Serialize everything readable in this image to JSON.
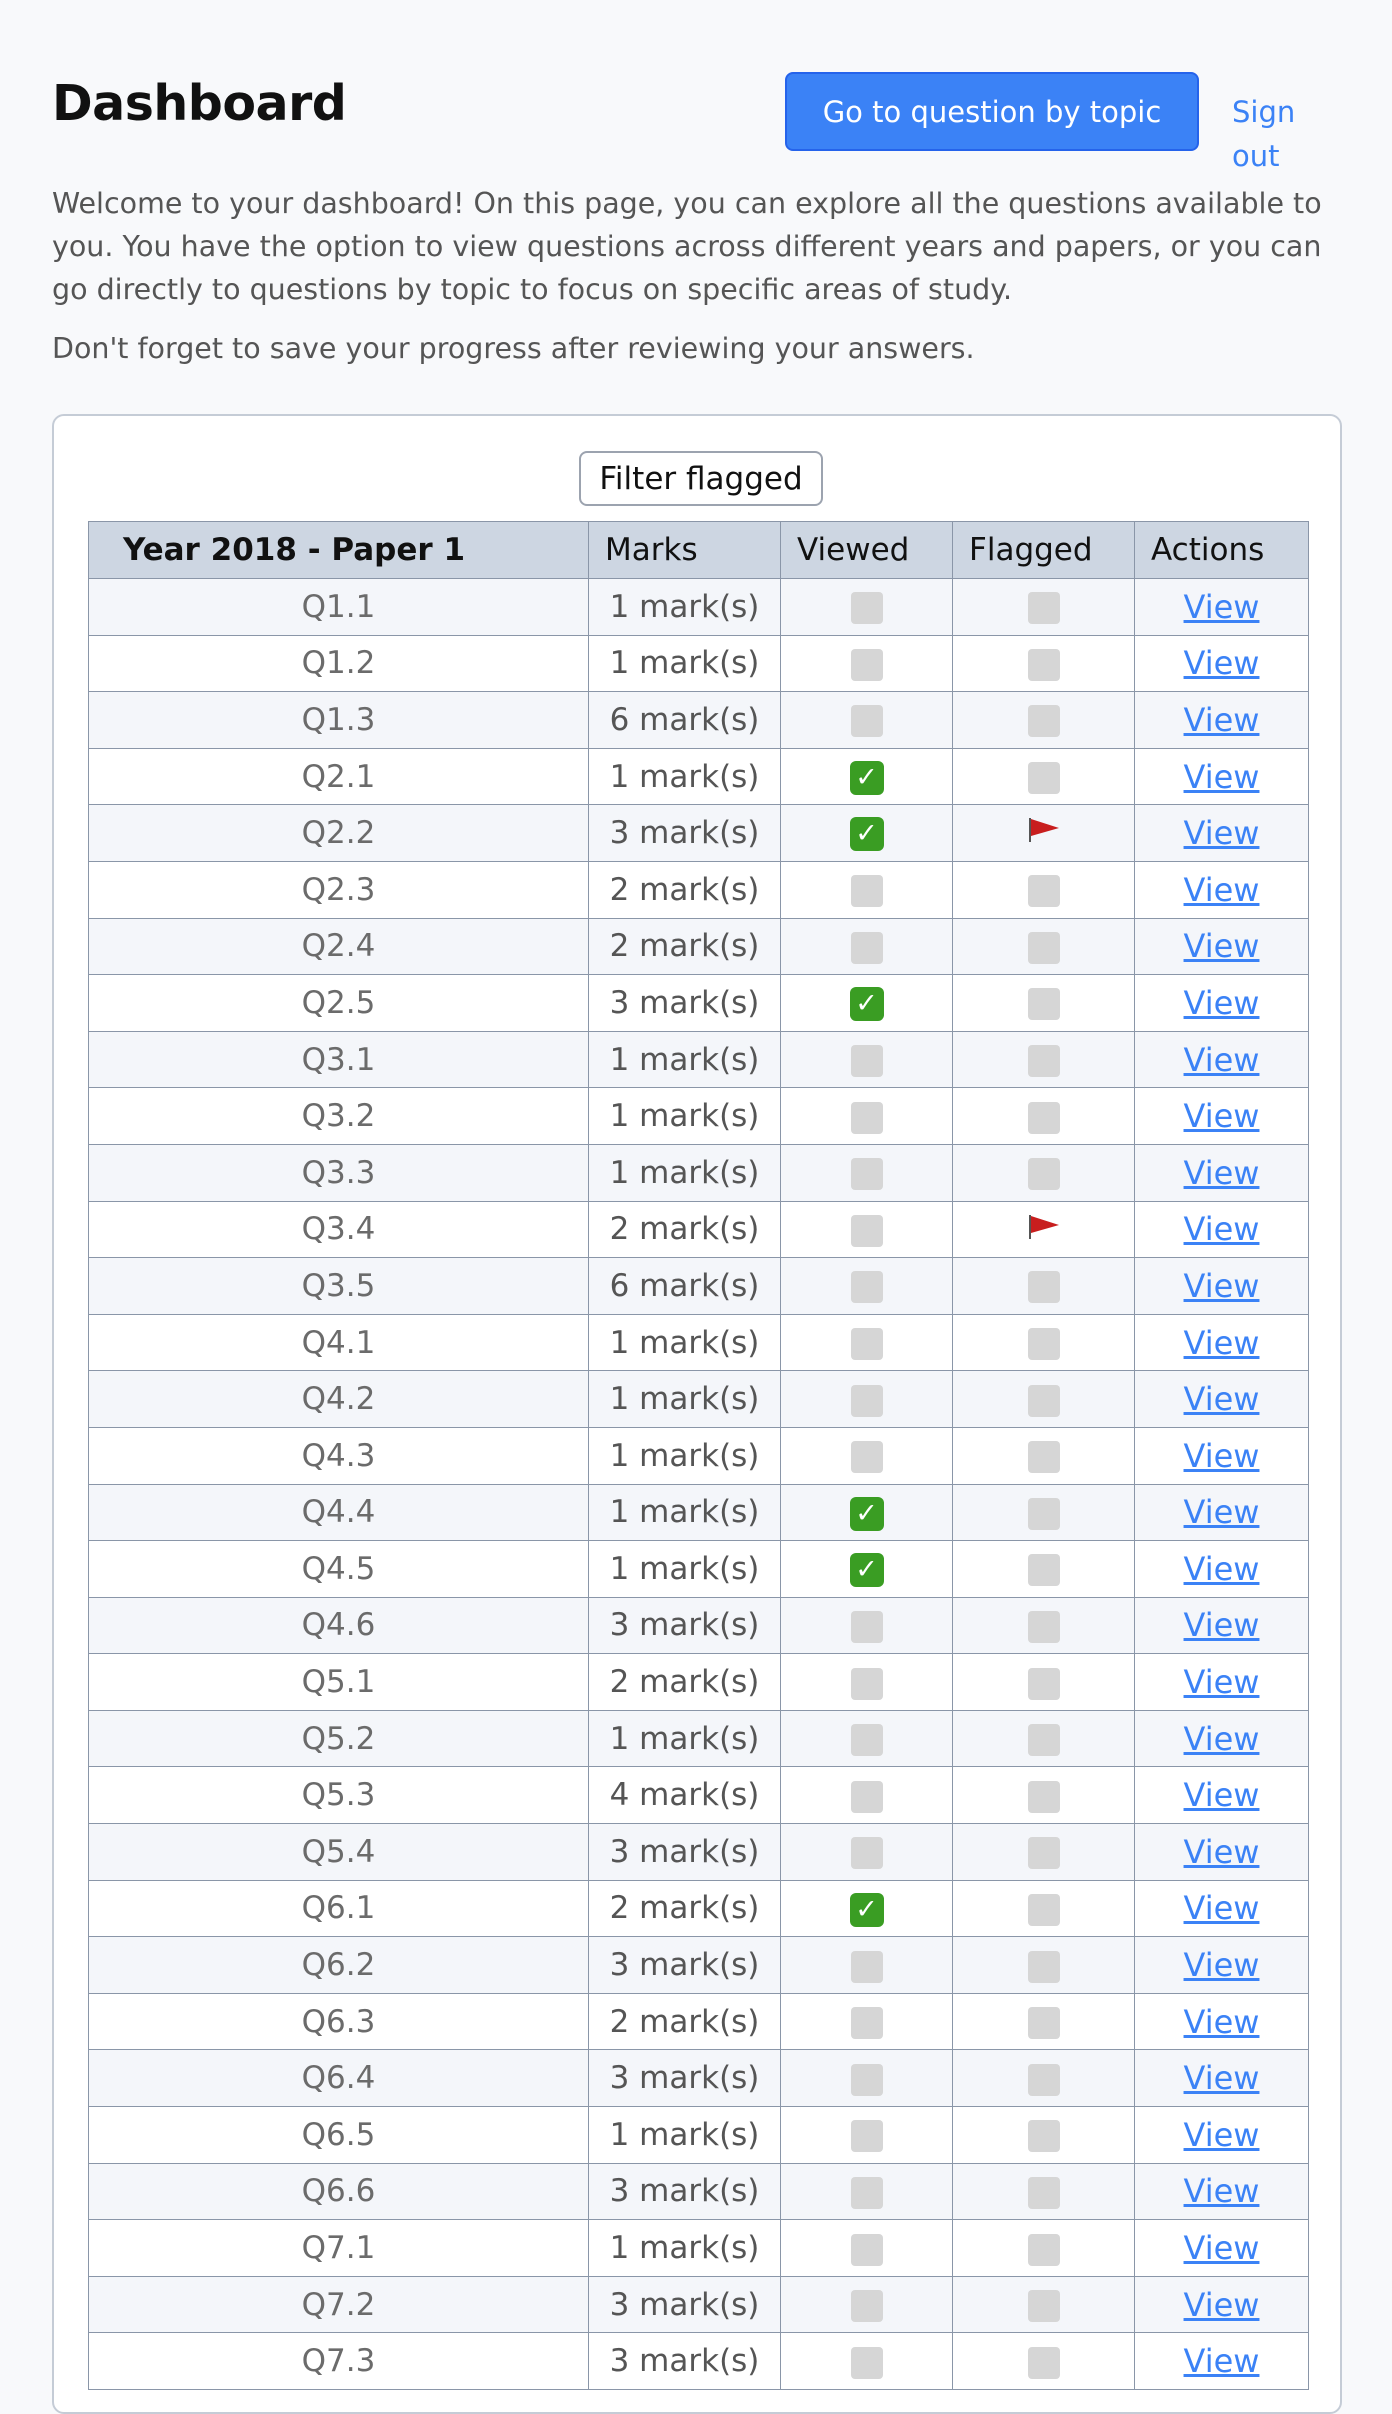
{
  "header": {
    "title": "Dashboard",
    "topic_button": "Go to question by topic",
    "signout": "Sign out"
  },
  "intro": {
    "paragraph1": "Welcome to your dashboard! On this page, you can explore all the questions available to you. You have the option to view questions across different years and papers, or you can go directly to questions by topic to focus on specific areas of study.",
    "paragraph2": "Don't forget to save your progress after reviewing your answers."
  },
  "filter_label": "Filter flagged",
  "table": {
    "columns": [
      "Year 2018 - Paper 1",
      "Marks",
      "Viewed",
      "Flagged",
      "Actions"
    ],
    "action_label": "View",
    "rows": [
      {
        "q": "Q1.1",
        "marks": "1 mark(s)",
        "viewed": false,
        "flagged": false
      },
      {
        "q": "Q1.2",
        "marks": "1 mark(s)",
        "viewed": false,
        "flagged": false
      },
      {
        "q": "Q1.3",
        "marks": "6 mark(s)",
        "viewed": false,
        "flagged": false
      },
      {
        "q": "Q2.1",
        "marks": "1 mark(s)",
        "viewed": true,
        "flagged": false
      },
      {
        "q": "Q2.2",
        "marks": "3 mark(s)",
        "viewed": true,
        "flagged": true
      },
      {
        "q": "Q2.3",
        "marks": "2 mark(s)",
        "viewed": false,
        "flagged": false
      },
      {
        "q": "Q2.4",
        "marks": "2 mark(s)",
        "viewed": false,
        "flagged": false
      },
      {
        "q": "Q2.5",
        "marks": "3 mark(s)",
        "viewed": true,
        "flagged": false
      },
      {
        "q": "Q3.1",
        "marks": "1 mark(s)",
        "viewed": false,
        "flagged": false
      },
      {
        "q": "Q3.2",
        "marks": "1 mark(s)",
        "viewed": false,
        "flagged": false
      },
      {
        "q": "Q3.3",
        "marks": "1 mark(s)",
        "viewed": false,
        "flagged": false
      },
      {
        "q": "Q3.4",
        "marks": "2 mark(s)",
        "viewed": false,
        "flagged": true
      },
      {
        "q": "Q3.5",
        "marks": "6 mark(s)",
        "viewed": false,
        "flagged": false
      },
      {
        "q": "Q4.1",
        "marks": "1 mark(s)",
        "viewed": false,
        "flagged": false
      },
      {
        "q": "Q4.2",
        "marks": "1 mark(s)",
        "viewed": false,
        "flagged": false
      },
      {
        "q": "Q4.3",
        "marks": "1 mark(s)",
        "viewed": false,
        "flagged": false
      },
      {
        "q": "Q4.4",
        "marks": "1 mark(s)",
        "viewed": true,
        "flagged": false
      },
      {
        "q": "Q4.5",
        "marks": "1 mark(s)",
        "viewed": true,
        "flagged": false
      },
      {
        "q": "Q4.6",
        "marks": "3 mark(s)",
        "viewed": false,
        "flagged": false
      },
      {
        "q": "Q5.1",
        "marks": "2 mark(s)",
        "viewed": false,
        "flagged": false
      },
      {
        "q": "Q5.2",
        "marks": "1 mark(s)",
        "viewed": false,
        "flagged": false
      },
      {
        "q": "Q5.3",
        "marks": "4 mark(s)",
        "viewed": false,
        "flagged": false
      },
      {
        "q": "Q5.4",
        "marks": "3 mark(s)",
        "viewed": false,
        "flagged": false
      },
      {
        "q": "Q6.1",
        "marks": "2 mark(s)",
        "viewed": true,
        "flagged": false
      },
      {
        "q": "Q6.2",
        "marks": "3 mark(s)",
        "viewed": false,
        "flagged": false
      },
      {
        "q": "Q6.3",
        "marks": "2 mark(s)",
        "viewed": false,
        "flagged": false
      },
      {
        "q": "Q6.4",
        "marks": "3 mark(s)",
        "viewed": false,
        "flagged": false
      },
      {
        "q": "Q6.5",
        "marks": "1 mark(s)",
        "viewed": false,
        "flagged": false
      },
      {
        "q": "Q6.6",
        "marks": "3 mark(s)",
        "viewed": false,
        "flagged": false
      },
      {
        "q": "Q7.1",
        "marks": "1 mark(s)",
        "viewed": false,
        "flagged": false
      },
      {
        "q": "Q7.2",
        "marks": "3 mark(s)",
        "viewed": false,
        "flagged": false
      },
      {
        "q": "Q7.3",
        "marks": "3 mark(s)",
        "viewed": false,
        "flagged": false
      }
    ]
  },
  "colors": {
    "accent": "#3b82f6",
    "check": "#3a9d23",
    "flag": "#c81e1e",
    "header_row": "#cdd6e2"
  }
}
